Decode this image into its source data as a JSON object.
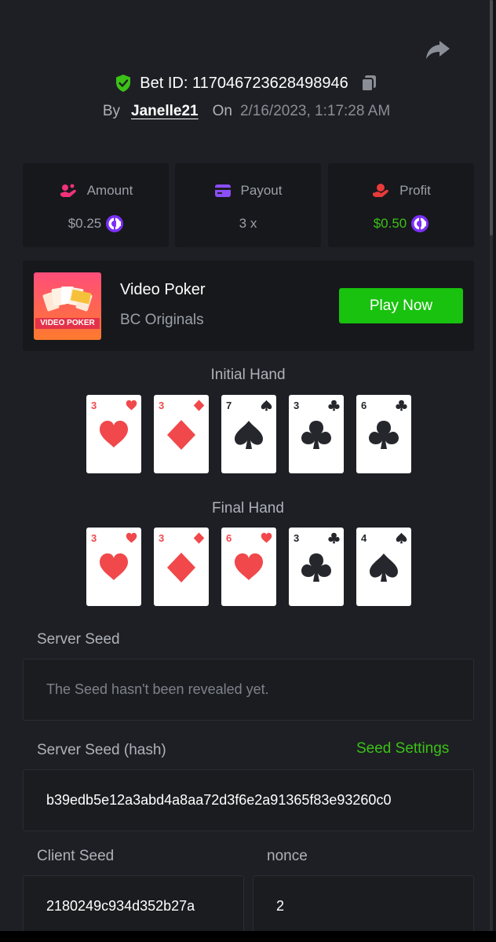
{
  "header": {
    "bet_id": "Bet ID: 117046723628498946",
    "by_label": "By",
    "username": "Janelle21",
    "on_label": "On",
    "date": "2/16/2023, 1:17:28 AM"
  },
  "stats": {
    "amount": {
      "label": "Amount",
      "value": "$0.25",
      "icon": "coin-hand-icon"
    },
    "payout": {
      "label": "Payout",
      "value": "3 x",
      "icon": "card-icon"
    },
    "profit": {
      "label": "Profit",
      "value": "$0.50",
      "icon": "hand-profit-icon"
    }
  },
  "game": {
    "name": "Video Poker",
    "provider": "BC Originals",
    "thumb_text": "VIDEO POKER",
    "play_label": "Play Now"
  },
  "initial_hand": {
    "title": "Initial Hand",
    "cards": [
      {
        "rank": "3",
        "suit": "hearts"
      },
      {
        "rank": "3",
        "suit": "diamonds"
      },
      {
        "rank": "7",
        "suit": "spades"
      },
      {
        "rank": "3",
        "suit": "clubs"
      },
      {
        "rank": "6",
        "suit": "clubs"
      }
    ]
  },
  "final_hand": {
    "title": "Final Hand",
    "cards": [
      {
        "rank": "3",
        "suit": "hearts"
      },
      {
        "rank": "3",
        "suit": "diamonds"
      },
      {
        "rank": "6",
        "suit": "hearts"
      },
      {
        "rank": "3",
        "suit": "clubs"
      },
      {
        "rank": "4",
        "suit": "spades"
      }
    ]
  },
  "seeds": {
    "server_seed_label": "Server Seed",
    "server_seed_value": "The Seed hasn't been revealed yet.",
    "server_hash_label": "Server Seed (hash)",
    "seed_settings_label": "Seed Settings",
    "server_hash_value": "b39edb5e12a3abd4a8aa72d3f6e2a91365f83e93260c0",
    "client_seed_label": "Client Seed",
    "client_seed_value": "2180249c934d352b27a",
    "nonce_label": "nonce",
    "nonce_value": "2"
  },
  "colors": {
    "accent_green": "#3bc117",
    "button_green": "#18c20e",
    "heart_red": "#f0484b",
    "coin_purple": "#7b2ff7"
  }
}
